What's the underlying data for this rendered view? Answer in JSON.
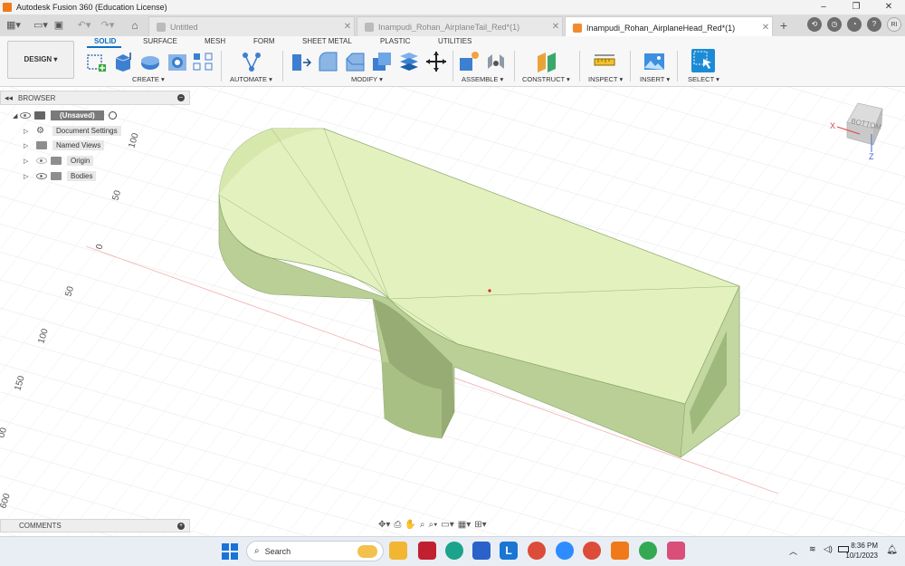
{
  "window": {
    "title": "Autodesk Fusion 360 (Education License)",
    "controls": [
      "–",
      "❐",
      "✕"
    ]
  },
  "tabs": [
    {
      "label": "Untitled",
      "active": false
    },
    {
      "label": "Inampudi_Rohan_AirplaneTail_Red*(1)",
      "active": false
    },
    {
      "label": "Inampudi_Rohan_AirplaneHead_Red*(1)",
      "active": true
    }
  ],
  "user": {
    "initials": "RI"
  },
  "ribbon": {
    "workspace": "DESIGN",
    "tabs": [
      "SOLID",
      "SURFACE",
      "MESH",
      "FORM",
      "SHEET METAL",
      "PLASTIC",
      "UTILITIES"
    ],
    "groups": [
      "CREATE",
      "AUTOMATE",
      "MODIFY",
      "ASSEMBLE",
      "CONSTRUCT",
      "INSPECT",
      "INSERT",
      "SELECT"
    ]
  },
  "browser": {
    "title": "BROWSER",
    "root": "(Unsaved)",
    "items": [
      "Document Settings",
      "Named Views",
      "Origin",
      "Bodies"
    ]
  },
  "comments": {
    "title": "COMMENTS"
  },
  "viewport": {
    "grid_labels": [
      "100",
      "50",
      "0",
      "50",
      "100",
      "150",
      "00",
      "600"
    ],
    "viewcube": {
      "face": "BOTTOM",
      "axis_x": "X",
      "axis_z": "Z"
    },
    "body_color": "#e3f1bf"
  },
  "taskbar": {
    "search_placeholder": "Search",
    "time": "8:36 PM",
    "date": "10/1/2023"
  }
}
